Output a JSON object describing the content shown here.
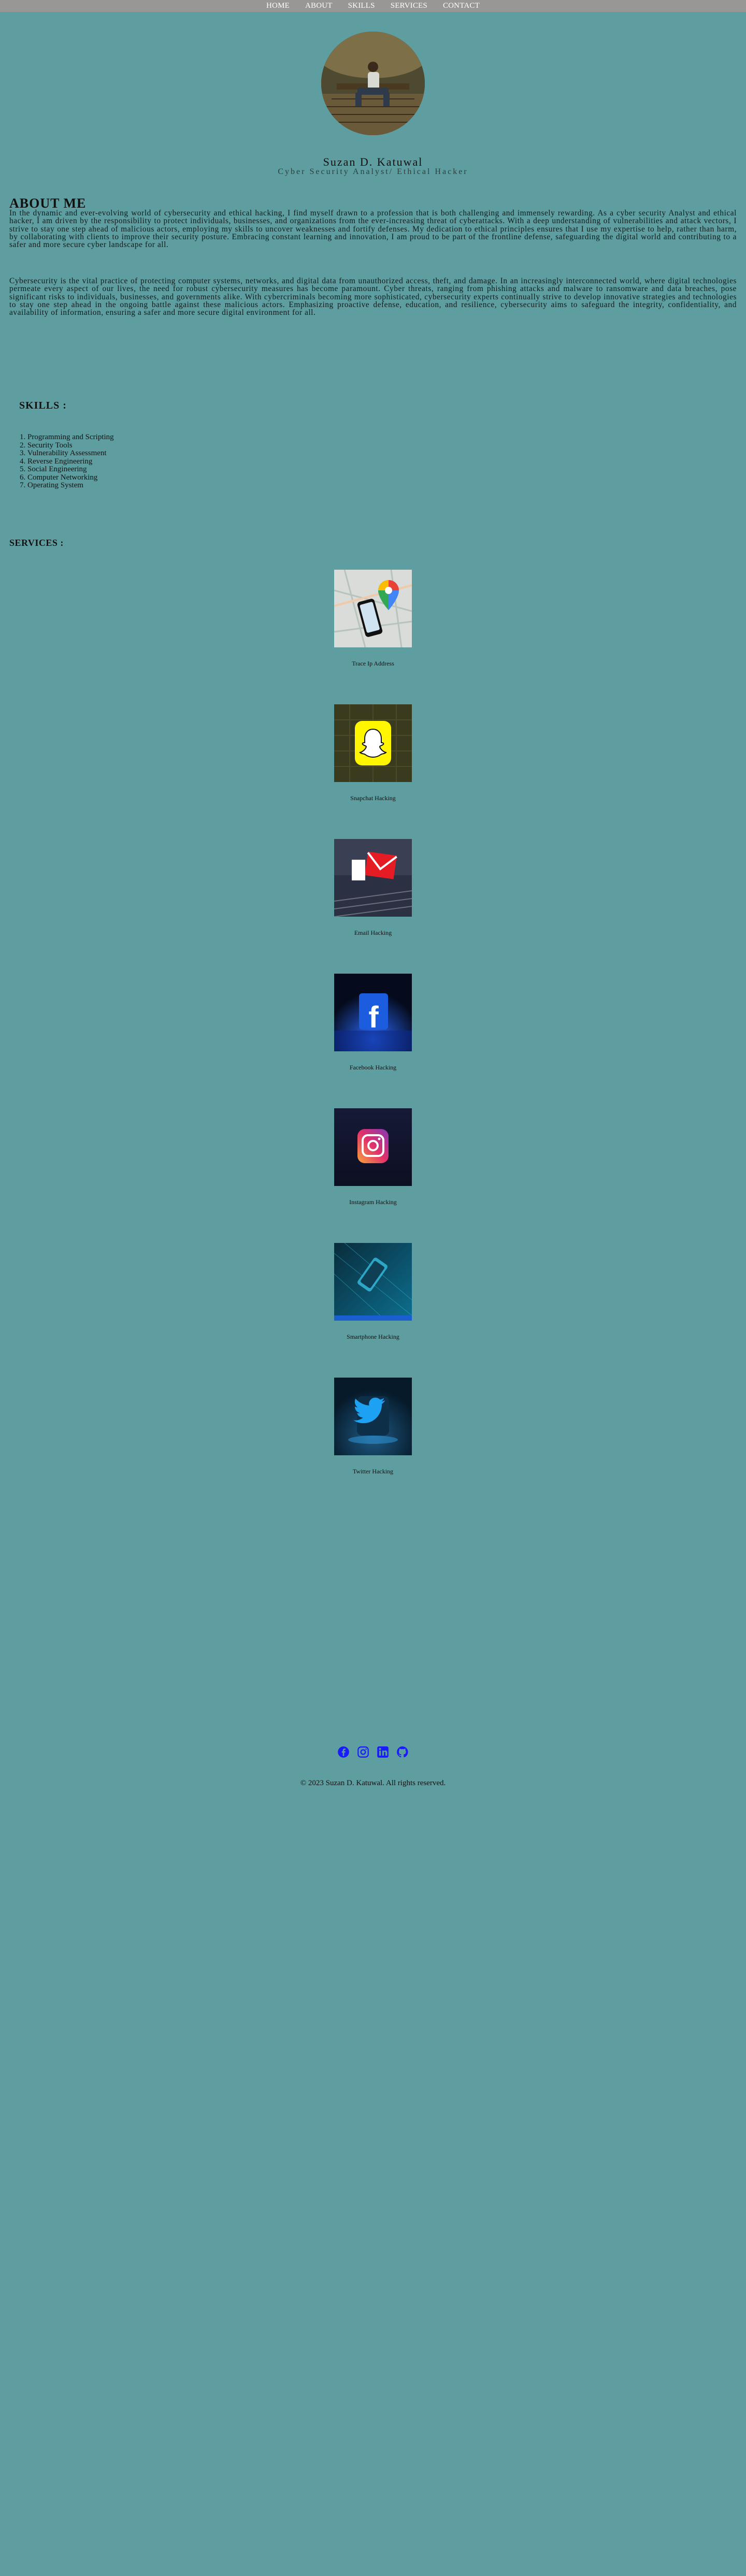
{
  "nav": {
    "items": [
      "HOME",
      "ABOUT",
      "SKILLS",
      "SERVICES",
      "CONTACT"
    ]
  },
  "profile": {
    "name": "Suzan D. Katuwal",
    "subtitle": "Cyber Security Analyst/ Ethical Hacker"
  },
  "about": {
    "title": "ABOUT ME",
    "paragraphs": [
      "In the dynamic and ever-evolving world of cybersecurity and ethical hacking, I find myself drawn to a profession that is both challenging and immensely rewarding. As a cyber security Analyst and ethical hacker, I am driven by the responsibility to protect individuals, businesses, and organizations from the ever-increasing threat of cyberattacks. With a deep understanding of vulnerabilities and attack vectors, I strive to stay one step ahead of malicious actors, employing my skills to uncover weaknesses and fortify defenses. My dedication to ethical principles ensures that I use my expertise to help, rather than harm, by collaborating with clients to improve their security posture. Embracing constant learning and innovation, I am proud to be part of the frontline defense, safeguarding the digital world and contributing to a safer and more secure cyber landscape for all.",
      "Cybersecurity is the vital practice of protecting computer systems, networks, and digital data from unauthorized access, theft, and damage. In an increasingly interconnected world, where digital technologies permeate every aspect of our lives, the need for robust cybersecurity measures has become paramount. Cyber threats, ranging from phishing attacks and malware to ransomware and data breaches, pose significant risks to individuals, businesses, and governments alike. With cybercriminals becoming more sophisticated, cybersecurity experts continually strive to develop innovative strategies and technologies to stay one step ahead in the ongoing battle against these malicious actors. Emphasizing proactive defense, education, and resilience, cybersecurity aims to safeguard the integrity, confidentiality, and availability of information, ensuring a safer and more secure digital environment for all."
    ]
  },
  "skills": {
    "title": "SKILLS :",
    "items": [
      "1. Programming and Scripting",
      "2. Security Tools",
      "3. Vulnerability Assessment",
      "4. Reverse Engineering",
      "5. Social Engineering",
      "6. Computer Networking",
      "7. Operating System"
    ]
  },
  "services": {
    "title": "SERVICES :",
    "items": [
      {
        "caption": "Trace Ip Address",
        "icon": "map-pin-phone-icon"
      },
      {
        "caption": "Snapchat Hacking",
        "icon": "snapchat-icon"
      },
      {
        "caption": "Email Hacking",
        "icon": "email-icon"
      },
      {
        "caption": "Facebook Hacking",
        "icon": "facebook-icon"
      },
      {
        "caption": "Instagram Hacking",
        "icon": "instagram-icon"
      },
      {
        "caption": "Smartphone Hacking",
        "icon": "smartphone-icon"
      },
      {
        "caption": "Twitter Hacking",
        "icon": "twitter-icon"
      }
    ]
  },
  "social": {
    "icons": [
      "facebook-icon",
      "instagram-icon",
      "linkedin-icon",
      "github-icon"
    ],
    "color": "#1a1aff"
  },
  "footer": {
    "text": "© 2023 Suzan D. Katuwal. All rights reserved."
  },
  "colors": {
    "background": "#5f9ea0",
    "nav": "#999696"
  }
}
